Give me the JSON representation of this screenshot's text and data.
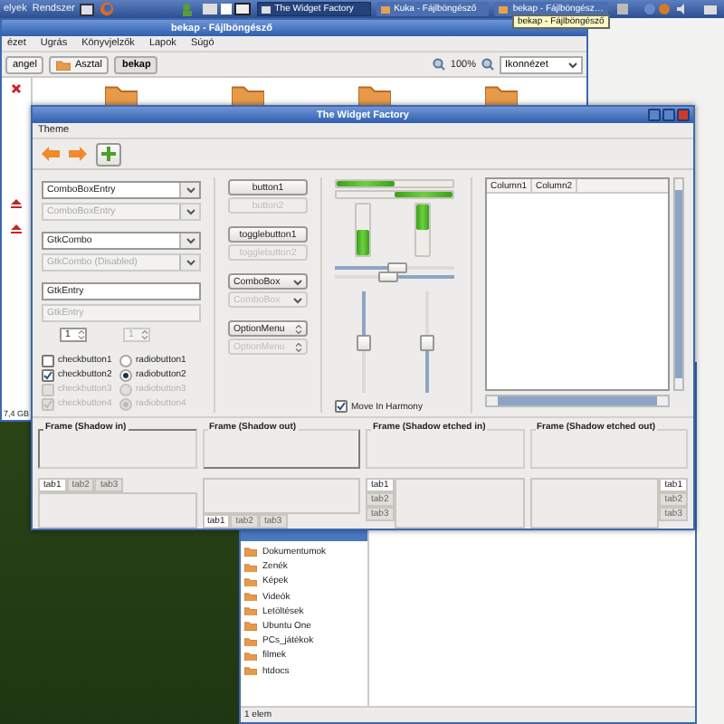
{
  "top_panel": {
    "menus": [
      "elyek",
      "Rendszer"
    ],
    "tasks": [
      {
        "label": "The Widget Factory",
        "selected": true
      },
      {
        "label": "Kuka - Fájlböngésző",
        "selected": false
      },
      {
        "label": "bekap - Fájlböngész…",
        "selected": false
      }
    ],
    "tooltip": "bekap - Fájlböngésző"
  },
  "file_browser": {
    "title": "bekap - Fájlböngésző",
    "menus": [
      "ézet",
      "Ugrás",
      "Könyvjelzők",
      "Lapok",
      "Súgó"
    ],
    "path": [
      {
        "label": "angel",
        "selected": false
      },
      {
        "label": "Asztal",
        "selected": false
      },
      {
        "label": "bekap",
        "selected": true
      }
    ],
    "zoom": "100%",
    "view": "Ikonnézet",
    "free_space": "7,4 GB"
  },
  "trash_browser": {
    "places": [
      "Dokumentumok",
      "Zenék",
      "Képek",
      "Videók",
      "Letöltések",
      "Ubuntu One",
      "PCs_játékok",
      "filmek",
      "htdocs"
    ],
    "status": "1 elem"
  },
  "widget_factory": {
    "title": "The Widget Factory",
    "menus": [
      "Theme"
    ],
    "fields": [
      {
        "kind": "combo_entry",
        "text": "ComboBoxEntry",
        "disabled": false
      },
      {
        "kind": "combo_entry",
        "text": "ComboBoxEntry",
        "disabled": true
      },
      {
        "kind": "combo",
        "text": "GtkCombo",
        "disabled": false
      },
      {
        "kind": "combo",
        "text": "GtkCombo (Disabled)",
        "disabled": true
      },
      {
        "kind": "entry",
        "text": "GtkEntry",
        "disabled": false
      },
      {
        "kind": "entry",
        "text": "GtkEntry",
        "disabled": true
      }
    ],
    "spins": [
      {
        "value": "1",
        "disabled": false
      },
      {
        "value": "1",
        "disabled": true
      }
    ],
    "checks": [
      {
        "label": "checkbutton1",
        "checked": false,
        "disabled": false
      },
      {
        "label": "checkbutton2",
        "checked": true,
        "disabled": false
      },
      {
        "label": "checkbutton3",
        "checked": false,
        "disabled": true
      },
      {
        "label": "checkbutton4",
        "checked": true,
        "disabled": true
      }
    ],
    "radios": [
      {
        "label": "radiobutton1",
        "selected": false,
        "disabled": false
      },
      {
        "label": "radiobutton2",
        "selected": true,
        "disabled": false
      },
      {
        "label": "radiobutton3",
        "selected": false,
        "disabled": true
      },
      {
        "label": "radiobutton4",
        "selected": true,
        "disabled": true
      }
    ],
    "buttons": [
      {
        "kind": "button",
        "label": "button1",
        "disabled": false
      },
      {
        "kind": "button",
        "label": "button2",
        "disabled": true
      },
      {
        "kind": "toggle",
        "label": "togglebutton1",
        "disabled": false
      },
      {
        "kind": "toggle",
        "label": "togglebutton2",
        "disabled": true
      },
      {
        "kind": "combo",
        "label": "ComboBox",
        "disabled": false
      },
      {
        "kind": "combo",
        "label": "ComboBox",
        "disabled": true
      },
      {
        "kind": "option",
        "label": "OptionMenu",
        "disabled": false
      },
      {
        "kind": "option",
        "label": "OptionMenu",
        "disabled": true
      }
    ],
    "progress": [
      {
        "kind": "left",
        "level": 0.5
      },
      {
        "kind": "right",
        "level": 0.5
      },
      {
        "kind": "bottom",
        "level": 0.5
      },
      {
        "kind": "top",
        "level": 0.5
      }
    ],
    "scales": [
      {
        "kind": "left",
        "level": 0.52
      },
      {
        "kind": "right",
        "level": 0.55
      },
      {
        "kind": "top",
        "level": 0.5
      },
      {
        "kind": "bottom",
        "level": 0.5
      }
    ],
    "harmony": {
      "label": "Move In Harmony",
      "checked": true
    },
    "tree": {
      "columns": [
        "Column1",
        "Column2"
      ]
    },
    "frames": [
      "Frame (Shadow in)",
      "Frame (Shadow out)",
      "Frame (Shadow etched in)",
      "Frame (Shadow etched out)"
    ],
    "notebooks": [
      {
        "kind": "top",
        "tabs": [
          {
            "label": "tab1",
            "selected": true
          },
          {
            "label": "tab2",
            "selected": false
          },
          {
            "label": "tab3",
            "selected": false
          }
        ]
      },
      {
        "kind": "bottom",
        "tabs": [
          {
            "label": "tab1",
            "selected": true
          },
          {
            "label": "tab2",
            "selected": false
          },
          {
            "label": "tab3",
            "selected": false
          }
        ]
      },
      {
        "kind": "left",
        "tabs": [
          {
            "label": "tab1",
            "selected": true
          },
          {
            "label": "tab2",
            "selected": false
          },
          {
            "label": "tab3",
            "selected": false
          }
        ]
      },
      {
        "kind": "right",
        "tabs": [
          {
            "label": "tab1",
            "selected": true
          },
          {
            "label": "tab2",
            "selected": false
          },
          {
            "label": "tab3",
            "selected": false
          }
        ]
      }
    ]
  }
}
